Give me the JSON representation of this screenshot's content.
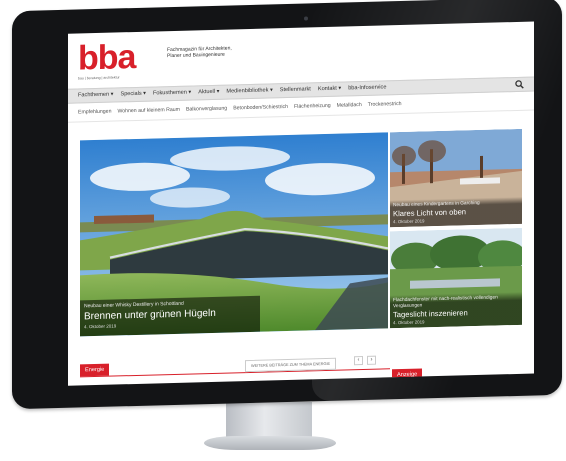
{
  "header": {
    "logo_text": "bba",
    "logo_subtitle": "bau | beratung | architektur",
    "tagline": "Fachmagazin für Architekten, Planer und Bauingenieure"
  },
  "nav": {
    "items": [
      {
        "label": "Fachthemen ▾"
      },
      {
        "label": "Specials ▾"
      },
      {
        "label": "Fokusthemen ▾"
      },
      {
        "label": "Aktuell ▾"
      },
      {
        "label": "Medienbibliothek ▾"
      },
      {
        "label": "Stellenmarkt"
      },
      {
        "label": "Kontakt ▾"
      },
      {
        "label": "bba-Infoservice"
      }
    ],
    "search_icon": "search-icon"
  },
  "subnav": {
    "items": [
      {
        "label": "Empfehlungen"
      },
      {
        "label": "Wohnen auf kleinem Raum"
      },
      {
        "label": "Balkonverglasung"
      },
      {
        "label": "Betonboden/Schiestrich"
      },
      {
        "label": "Flächenheizung"
      },
      {
        "label": "Metalldach"
      },
      {
        "label": "Trockenestrich"
      }
    ]
  },
  "hero": {
    "kicker": "Neubau einer Whisky Destillery in Schottland",
    "title": "Brennen unter grünen Hügeln",
    "date": "4. Oktober 2019"
  },
  "cards": [
    {
      "kicker": "Neubau eines Kindergartens in Garching",
      "title": "Klares Licht von oben",
      "date": "4. Oktober 2019"
    },
    {
      "kicker": "Flachdachfenster mit nach-realistisch vollendigen Verglasungen",
      "title": "Tageslicht inszenieren",
      "date": "4. Oktober 2019"
    }
  ],
  "section": {
    "tab_label": "Energie",
    "more_label": "WEITERE BEITRÄGE ZUM THEMA ENERGIE",
    "prev_label": "‹",
    "next_label": "›",
    "ad_label": "Anzeige"
  },
  "colors": {
    "brand": "#d8202a",
    "nav_bg": "#e4e4e4",
    "bezel": "#131416"
  }
}
